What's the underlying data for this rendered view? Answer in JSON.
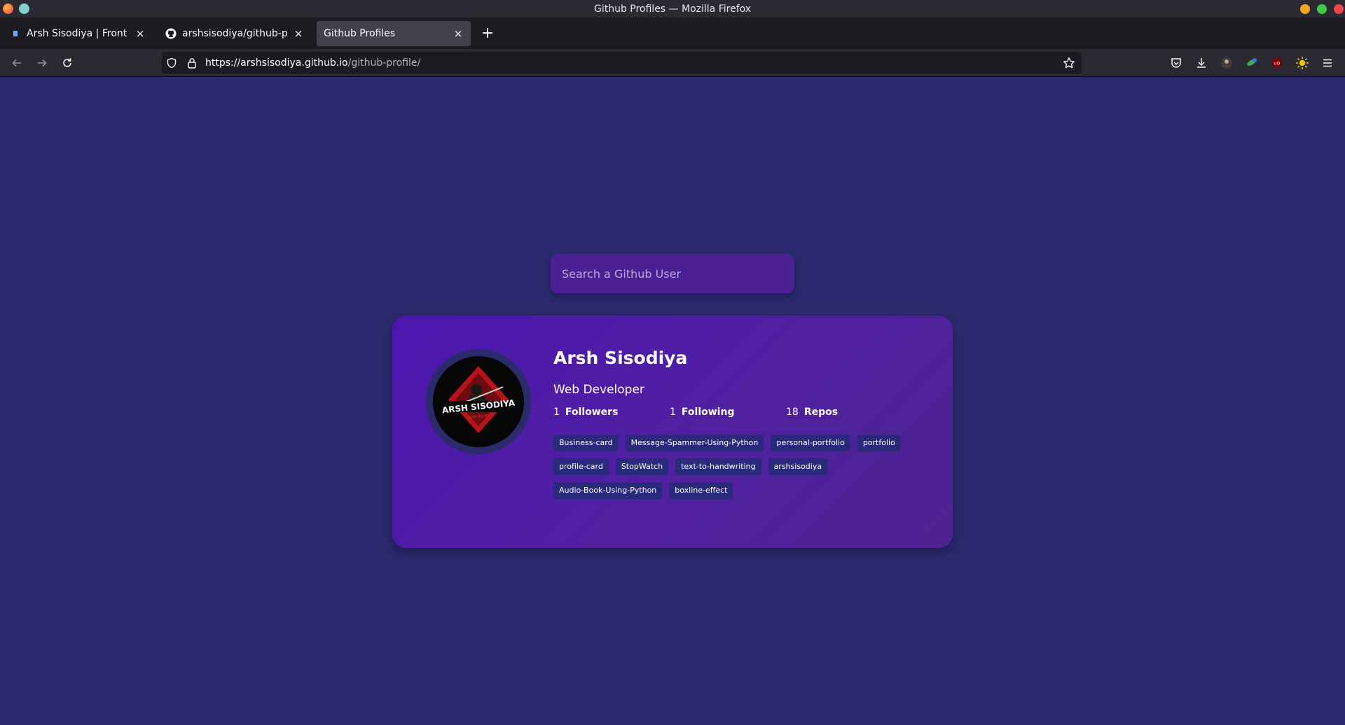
{
  "window": {
    "title": "Github Profiles — Mozilla Firefox"
  },
  "tabs": [
    {
      "label": "Arsh Sisodiya | Front End",
      "icon": "site-favicon"
    },
    {
      "label": "arshsisodiya/github-profi",
      "icon": "github-icon"
    },
    {
      "label": "Github Profiles",
      "icon": "none",
      "active": true
    }
  ],
  "navbar": {
    "url_host": "https://arshsisodiya.github.io",
    "url_path": "/github-profile/"
  },
  "search": {
    "placeholder": "Search a Github User"
  },
  "profile": {
    "name": "Arsh Sisodiya",
    "bio": "Web Developer",
    "avatar_text": "ARSH SISODIYA",
    "avatar_subtext": "TEAM RELIEF",
    "stats": [
      {
        "value": "1",
        "label": "Followers"
      },
      {
        "value": "1",
        "label": "Following"
      },
      {
        "value": "18",
        "label": "Repos"
      }
    ],
    "repos": [
      "Business-card",
      "Message-Spammer-Using-Python",
      "personal-portfolio",
      "portfolio",
      "profile-card",
      "StopWatch",
      "text-to-handwriting",
      "arshsisodiya",
      "Audio-Book-Using-Python",
      "boxline-effect"
    ]
  },
  "colors": {
    "page_bg": "#2c2a6e",
    "card_bg": "#4c16b0",
    "search_bg": "#4c2095",
    "tag_bg": "#2a2a7c"
  }
}
